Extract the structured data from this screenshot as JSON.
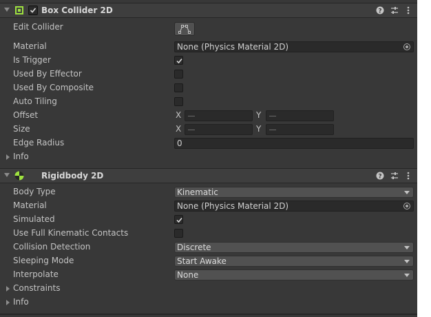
{
  "box_collider": {
    "title": "Box Collider 2D",
    "edit_collider_label": "Edit Collider",
    "material_label": "Material",
    "material_value": "None (Physics Material 2D)",
    "is_trigger_label": "Is Trigger",
    "is_trigger": true,
    "used_by_effector_label": "Used By Effector",
    "used_by_composite_label": "Used By Composite",
    "auto_tiling_label": "Auto Tiling",
    "offset_label": "Offset",
    "size_label": "Size",
    "x_label": "X",
    "y_label": "Y",
    "edge_radius_label": "Edge Radius",
    "edge_radius_value": "0",
    "info_label": "Info"
  },
  "rigidbody": {
    "title": "Rigidbody 2D",
    "body_type_label": "Body Type",
    "body_type_value": "Kinematic",
    "material_label": "Material",
    "material_value": "None (Physics Material 2D)",
    "simulated_label": "Simulated",
    "simulated": true,
    "full_kinematic_label": "Use Full Kinematic Contacts",
    "collision_detection_label": "Collision Detection",
    "collision_detection_value": "Discrete",
    "sleeping_mode_label": "Sleeping Mode",
    "sleeping_mode_value": "Start Awake",
    "interpolate_label": "Interpolate",
    "interpolate_value": "None",
    "constraints_label": "Constraints",
    "info_label": "Info"
  },
  "icons": {
    "help": "help-icon",
    "presets": "presets-icon",
    "menu": "kebab-menu-icon",
    "box_collider": "box-collider-icon",
    "rigidbody": "rigidbody-icon",
    "object_picker": "object-picker-icon",
    "edit_collider": "edit-collider-icon"
  },
  "colors": {
    "collider_green": "#9ee23f",
    "panel_bg": "#383838",
    "header_bg": "#3e3e3e"
  }
}
